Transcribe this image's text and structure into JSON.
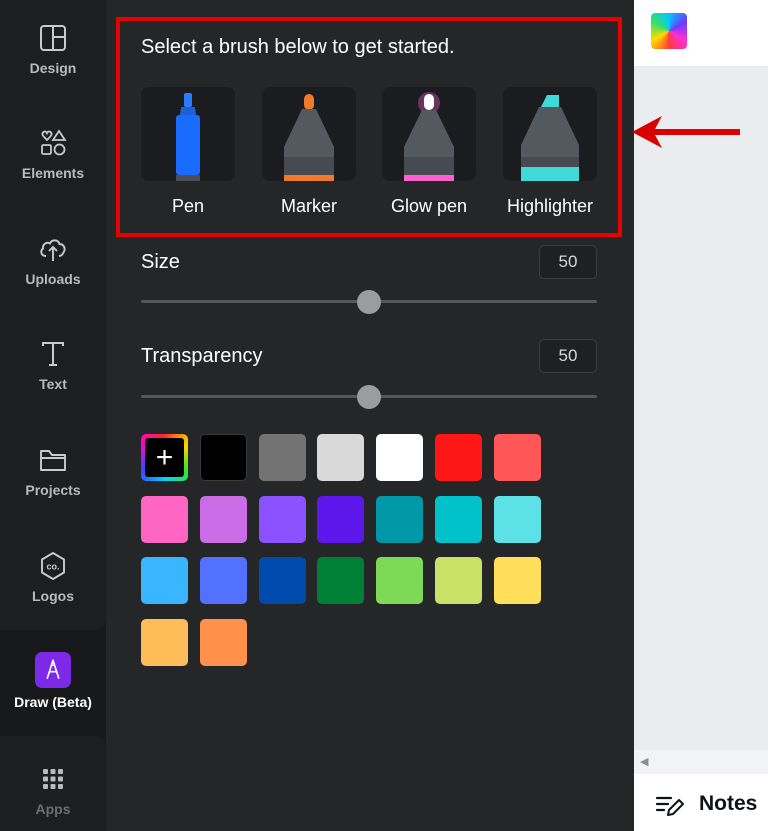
{
  "nav": {
    "items": [
      {
        "label": "Design",
        "icon": "layout-icon"
      },
      {
        "label": "Elements",
        "icon": "shapes-icon"
      },
      {
        "label": "Uploads",
        "icon": "cloud-upload-icon"
      },
      {
        "label": "Text",
        "icon": "text-icon"
      },
      {
        "label": "Projects",
        "icon": "folder-icon"
      },
      {
        "label": "Logos",
        "icon": "logo-co-icon"
      },
      {
        "label": "Draw (Beta)",
        "icon": "draw-icon"
      },
      {
        "label": "Apps",
        "icon": "apps-grid-icon"
      }
    ],
    "active": "Draw (Beta)"
  },
  "brushes": {
    "title": "Select a brush below to get started.",
    "items": [
      {
        "label": "Pen",
        "color": "#1a6cff"
      },
      {
        "label": "Marker",
        "color": "#f07a2a"
      },
      {
        "label": "Glow pen",
        "color": "#ff5fd0"
      },
      {
        "label": "Highlighter",
        "color": "#3fd9d9"
      }
    ]
  },
  "size": {
    "label": "Size",
    "value": "50",
    "fraction": 0.5
  },
  "transparency": {
    "label": "Transparency",
    "value": "50",
    "fraction": 0.5
  },
  "palette": {
    "add_symbol": "+",
    "colors": [
      "#000000",
      "#737373",
      "#d9d9d9",
      "#ffffff",
      "#ff1616",
      "#ff5757",
      "#ff66c4",
      "#cb6ce6",
      "#8c52ff",
      "#5e17eb",
      "#0097a7",
      "#00c2cb",
      "#5ce1e6",
      "#38b6ff",
      "#5271ff",
      "#004aad",
      "#008037",
      "#7ed957",
      "#c9e265",
      "#ffde59",
      "#ffbd59",
      "#ff914d"
    ]
  },
  "canvas": {
    "collapse_glyph": "‹",
    "notes_label": "Notes",
    "scroll_glyph": "◀"
  },
  "accent": {
    "highlight_border": "#e60000",
    "arrow": "#d90000",
    "draw_badge": "#7d2ae8"
  }
}
